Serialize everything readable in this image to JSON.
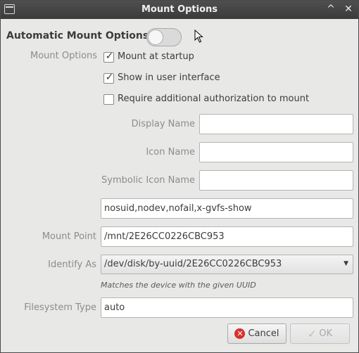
{
  "window": {
    "title": "Mount Options"
  },
  "heading": "Automatic Mount Options",
  "toggle": {
    "state": "off"
  },
  "options_label": "Mount Options",
  "checkboxes": [
    {
      "label": "Mount at startup",
      "checked": true
    },
    {
      "label": "Show in user interface",
      "checked": true
    },
    {
      "label": "Require additional authorization to mount",
      "checked": false
    }
  ],
  "fields": {
    "display_name": {
      "label": "Display Name",
      "value": ""
    },
    "icon_name": {
      "label": "Icon Name",
      "value": ""
    },
    "symbolic_icon_name": {
      "label": "Symbolic Icon Name",
      "value": ""
    },
    "options_value": "nosuid,nodev,nofail,x-gvfs-show",
    "mount_point": {
      "label": "Mount Point",
      "value": "/mnt/2E26CC0226CBC953"
    },
    "identify_as": {
      "label": "Identify As",
      "value": "/dev/disk/by-uuid/2E26CC0226CBC953"
    },
    "identify_hint": "Matches the device with the given UUID",
    "filesystem_type": {
      "label": "Filesystem Type",
      "value": "auto"
    }
  },
  "buttons": {
    "cancel": "Cancel",
    "ok": "OK"
  },
  "icons": {
    "window_menu": "window-menu-icon",
    "maximize": "chevron-up-icon",
    "close": "close-icon",
    "cancel": "cancel-icon",
    "ok": "checkmark-icon"
  }
}
